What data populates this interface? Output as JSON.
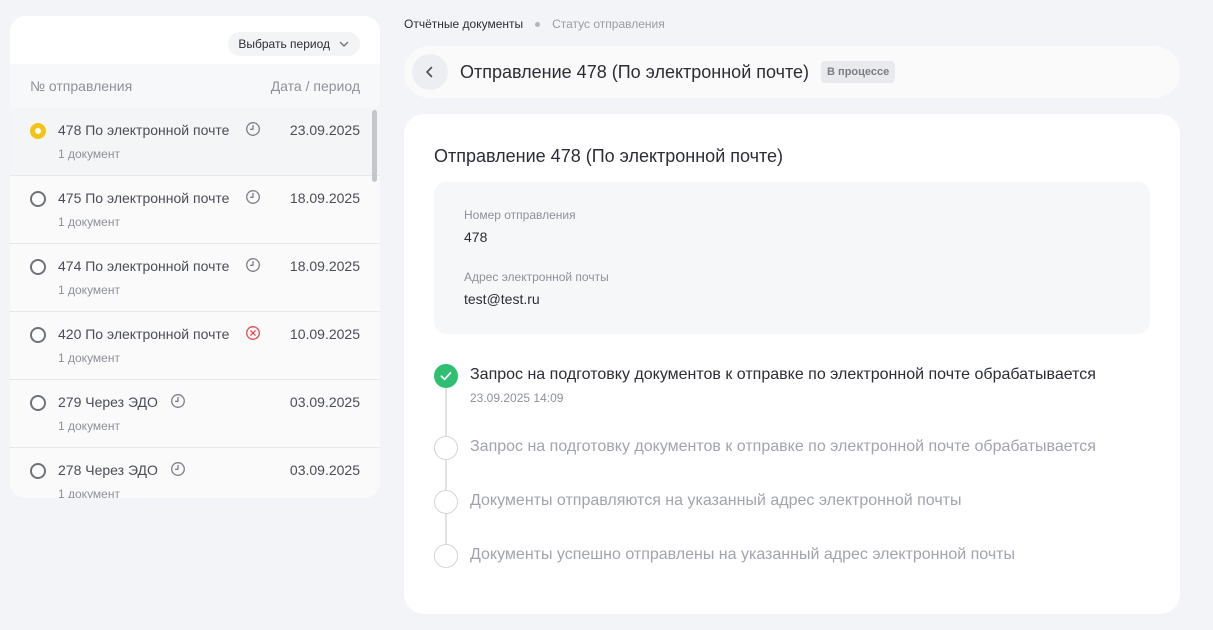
{
  "left": {
    "period_button": "Выбрать период",
    "col_number": "№ отправления",
    "col_date": "Дата / период",
    "rows": [
      {
        "title": "478 По электронной почте",
        "sub": "1 документ",
        "date": "23.09.2025",
        "status": "pending",
        "active": true
      },
      {
        "title": "475 По электронной почте",
        "sub": "1 документ",
        "date": "18.09.2025",
        "status": "pending",
        "active": false
      },
      {
        "title": "474 По электронной почте",
        "sub": "1 документ",
        "date": "18.09.2025",
        "status": "pending",
        "active": false
      },
      {
        "title": "420 По электронной почте",
        "sub": "1 документ",
        "date": "10.09.2025",
        "status": "error",
        "active": false
      },
      {
        "title": "279 Через ЭДО",
        "sub": "1 документ",
        "date": "03.09.2025",
        "status": "pending",
        "active": false
      },
      {
        "title": "278 Через ЭДО",
        "sub": "1 документ",
        "date": "03.09.2025",
        "status": "pending",
        "active": false
      }
    ]
  },
  "breadcrumb": {
    "item1": "Отчётные документы",
    "item2": "Статус отправления"
  },
  "header": {
    "title": "Отправление 478 (По электронной почте)",
    "status": "В процессе"
  },
  "card": {
    "title": "Отправление 478 (По электронной почте)",
    "number_label": "Номер отправления",
    "number_value": "478",
    "email_label": "Адрес электронной почты",
    "email_value": "test@test.ru"
  },
  "timeline": [
    {
      "text": "Запрос на подготовку документов к отправке по электронной почте обрабатывается",
      "time": "23.09.2025 14:09",
      "done": true
    },
    {
      "text": "Запрос на подготовку документов к отправке по электронной почте обрабатывается",
      "time": "",
      "done": false
    },
    {
      "text": "Документы отправляются на указанный адрес электронной почты",
      "time": "",
      "done": false
    },
    {
      "text": "Документы успешно отправлены на указанный адрес электронной почты",
      "time": "",
      "done": false
    }
  ],
  "colors": {
    "accent_yellow": "#f3c316",
    "done_green": "#2fbf71",
    "error_red": "#e5484d"
  },
  "icons": {
    "pending": "clock-icon",
    "error": "error-circle-icon",
    "back": "chevron-left-icon",
    "period": "chevron-down-icon",
    "done": "check-icon"
  }
}
